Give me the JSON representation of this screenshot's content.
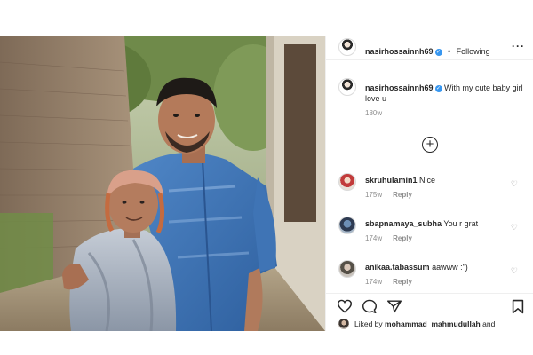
{
  "post": {
    "owner_username": "nasirhossainnh69",
    "follow_status": "Following",
    "separator": "•",
    "more_icon": "more-options-icon",
    "caption_text": "With my cute baby girl love u",
    "caption_age": "180w"
  },
  "comments": [
    {
      "username": "skruhulamin1",
      "text": "Nice",
      "age": "175w",
      "reply_label": "Reply"
    },
    {
      "username": "sbapnamaya_subha",
      "text": "You r grat",
      "age": "174w",
      "reply_label": "Reply"
    },
    {
      "username": "anikaa.tabassum",
      "text": "aawww :\")",
      "age": "174w",
      "reply_label": "Reply"
    }
  ],
  "liked_by": {
    "prefix": "Liked by",
    "username": "mohammad_mahmudullah",
    "suffix": "and"
  },
  "icons": [
    "heart-icon",
    "comment-icon",
    "share-icon",
    "bookmark-icon",
    "load-more-comments-icon",
    "verified-badge-icon"
  ],
  "colors": {
    "verified_blue": "#3897f0",
    "text": "#262626",
    "muted": "#8e8e8e",
    "divider": "#efefef"
  }
}
